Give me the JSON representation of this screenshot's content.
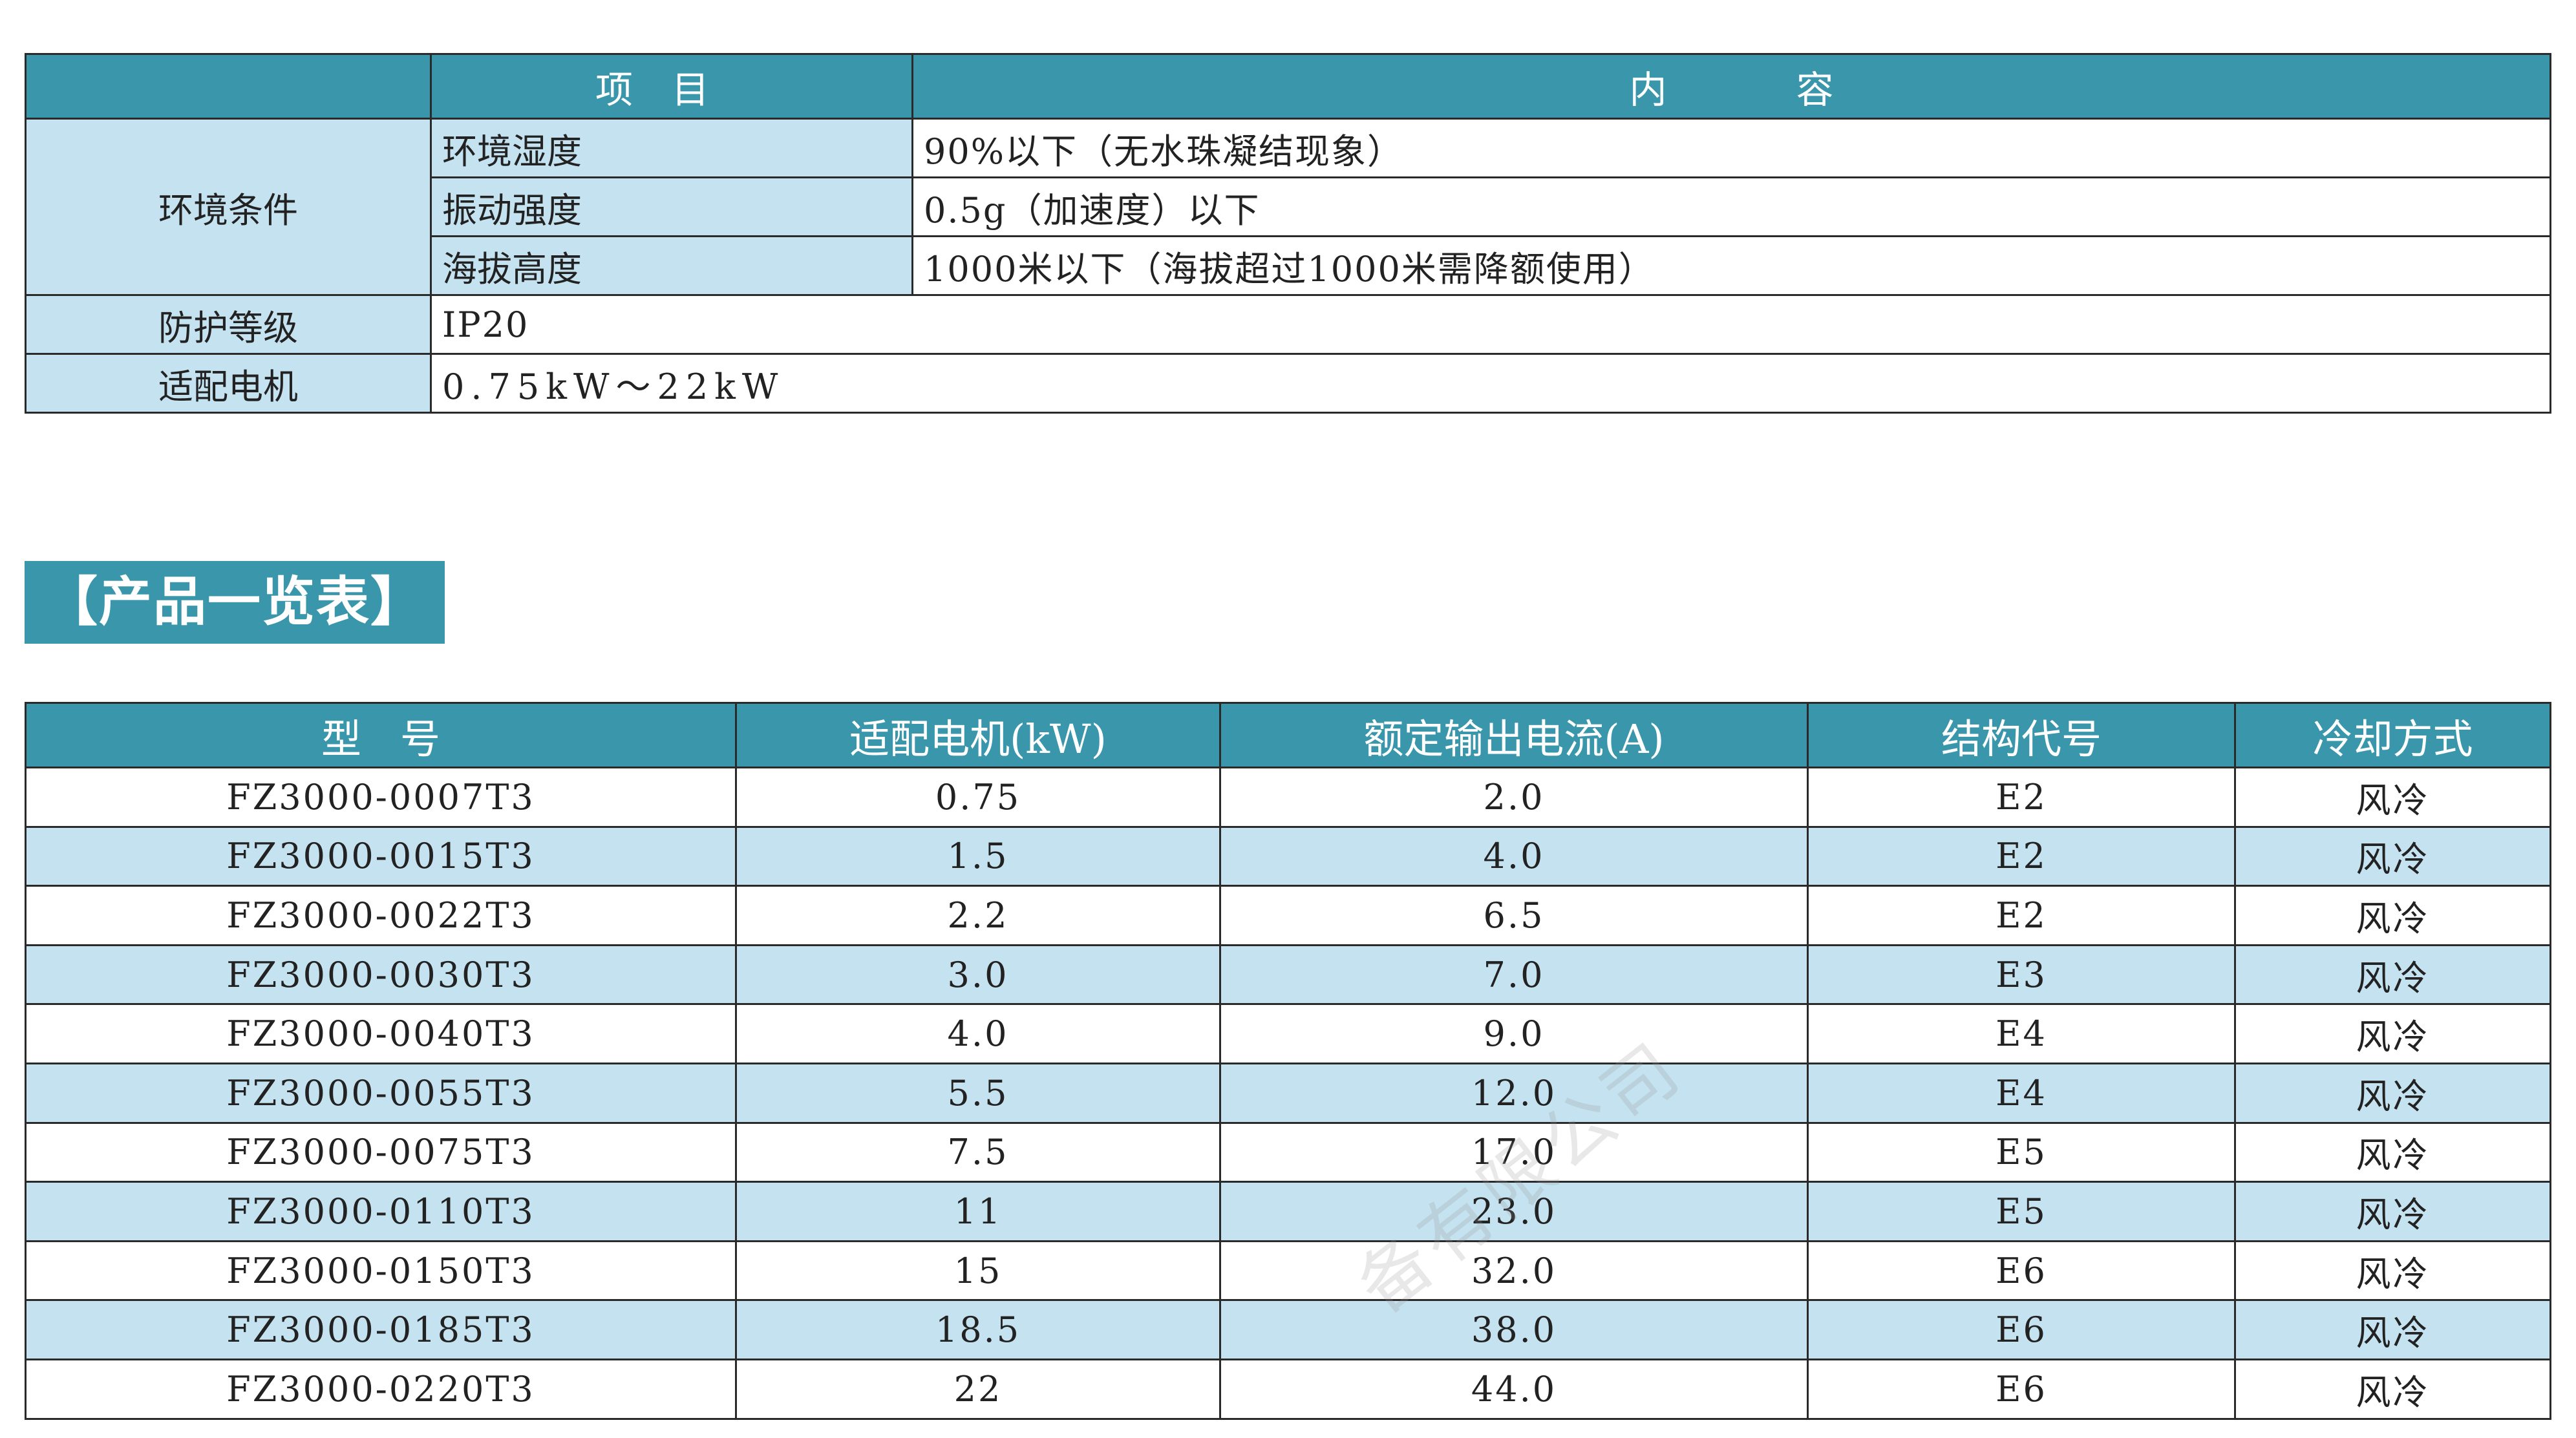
{
  "spec_table": {
    "header": {
      "item": "项目",
      "content": "内容"
    },
    "environment": {
      "category": "环境条件",
      "rows": [
        {
          "label": "环境湿度",
          "value": "90%以下（无水珠凝结现象）"
        },
        {
          "label": "振动强度",
          "value": "0.5g（加速度）以下"
        },
        {
          "label": "海拔高度",
          "value": "1000米以下（海拔超过1000米需降额使用）"
        }
      ]
    },
    "protection": {
      "label": "防护等级",
      "value": "IP20"
    },
    "motor": {
      "label": "适配电机",
      "value": "0.75kW～22kW"
    }
  },
  "section_title": "【产品一览表】",
  "product_table": {
    "headers": [
      "型号",
      "适配电机(kW)",
      "额定输出电流(A)",
      "结构代号",
      "冷却方式"
    ],
    "rows": [
      [
        "FZ3000-0007T3",
        "0.75",
        "2.0",
        "E2",
        "风冷"
      ],
      [
        "FZ3000-0015T3",
        "1.5",
        "4.0",
        "E2",
        "风冷"
      ],
      [
        "FZ3000-0022T3",
        "2.2",
        "6.5",
        "E2",
        "风冷"
      ],
      [
        "FZ3000-0030T3",
        "3.0",
        "7.0",
        "E3",
        "风冷"
      ],
      [
        "FZ3000-0040T3",
        "4.0",
        "9.0",
        "E4",
        "风冷"
      ],
      [
        "FZ3000-0055T3",
        "5.5",
        "12.0",
        "E4",
        "风冷"
      ],
      [
        "FZ3000-0075T3",
        "7.5",
        "17.0",
        "E5",
        "风冷"
      ],
      [
        "FZ3000-0110T3",
        "11",
        "23.0",
        "E5",
        "风冷"
      ],
      [
        "FZ3000-0150T3",
        "15",
        "32.0",
        "E6",
        "风冷"
      ],
      [
        "FZ3000-0185T3",
        "18.5",
        "38.0",
        "E6",
        "风冷"
      ],
      [
        "FZ3000-0220T3",
        "22",
        "44.0",
        "E6",
        "风冷"
      ]
    ]
  },
  "watermark": "备有限公司",
  "colors": {
    "header_bg": "#3a97ab",
    "stripe_bg": "#c4e2ef",
    "border": "#2a2a2a"
  }
}
